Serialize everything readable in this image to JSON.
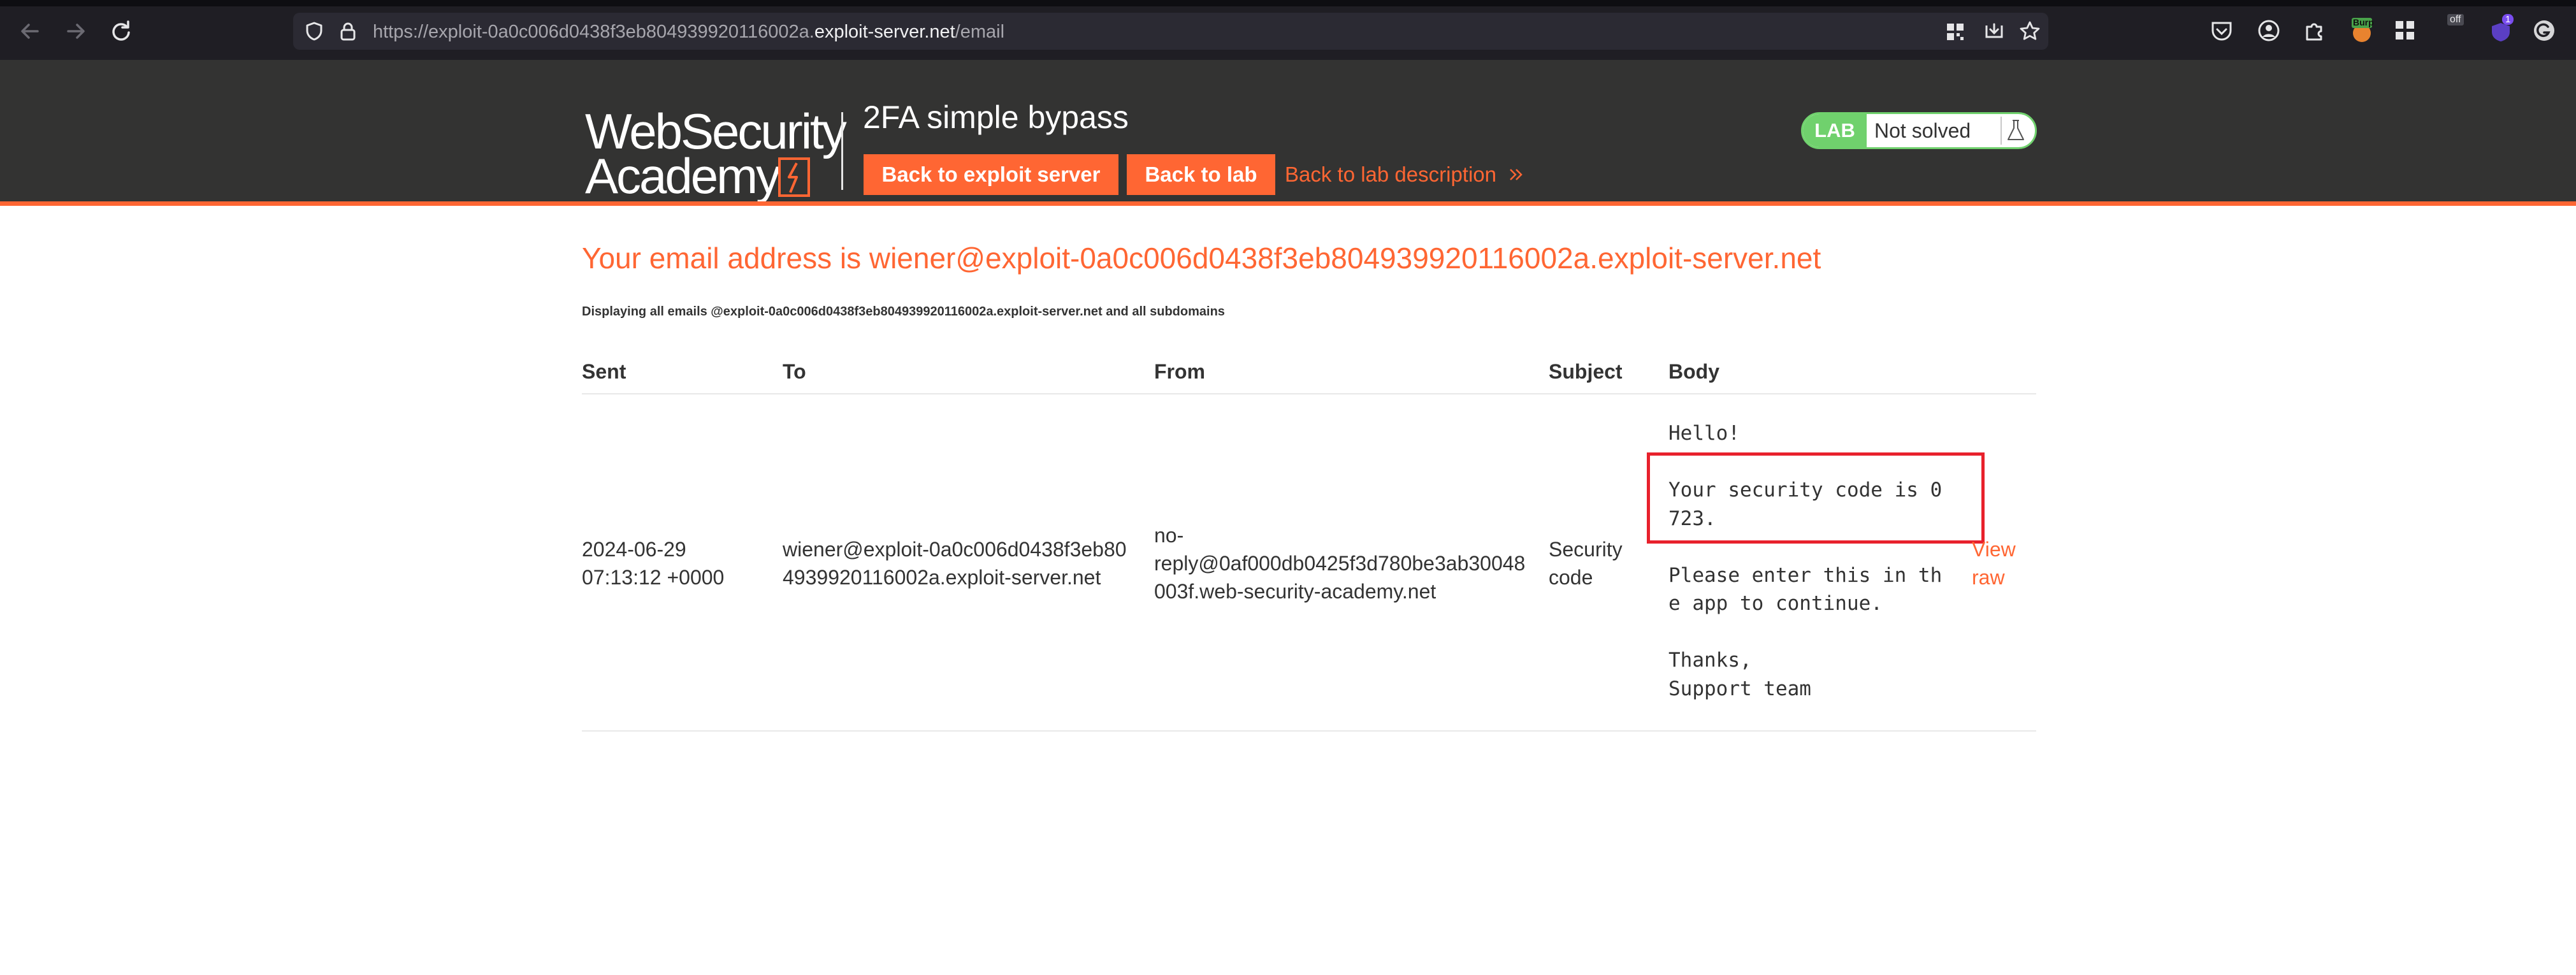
{
  "browser": {
    "url_prefix": "https://exploit-0a0c006d0438f3eb804939920116002a.",
    "url_host": "exploit-server.net",
    "url_path": "/email",
    "extension_badges": {
      "burp": "Burp",
      "off": "off",
      "count": "1"
    }
  },
  "lab_header": {
    "logo_line1": "WebSecurity",
    "logo_line2": "Academy",
    "title": "2FA simple bypass",
    "back_to_exploit_server": "Back to exploit server",
    "back_to_lab": "Back to lab",
    "back_to_description": "Back to lab description",
    "status_badge": "LAB",
    "status_text": "Not solved"
  },
  "content": {
    "heading": "Your email address is wiener@exploit-0a0c006d0438f3eb804939920116002a.exploit-server.net",
    "note": "Displaying all emails @exploit-0a0c006d0438f3eb804939920116002a.exploit-server.net and all subdomains",
    "columns": {
      "sent": "Sent",
      "to": "To",
      "from": "From",
      "subject": "Subject",
      "body": "Body"
    },
    "emails": [
      {
        "sent_date": "2024-06-29",
        "sent_time": "07:13:12 +0000",
        "to_line1": "wiener@exploit-0a0c006d0438f3eb80",
        "to_line2": "4939920116002a.exploit-server.net",
        "from_line1": "no-",
        "from_line2": "reply@0af000db0425f3d780be3ab30048",
        "from_line3": "003f.web-security-academy.net",
        "subject_line1": "Security",
        "subject_line2": "code",
        "body": "Hello!\n\nYour security code is 0\n723.\n\nPlease enter this in th\ne app to continue.\n\nThanks,\nSupport team",
        "view_raw": "View raw"
      }
    ]
  },
  "colors": {
    "accent": "#ff6633",
    "header_bg": "#333332",
    "solved_green": "#70d16d",
    "highlight_red": "#e8212c"
  }
}
